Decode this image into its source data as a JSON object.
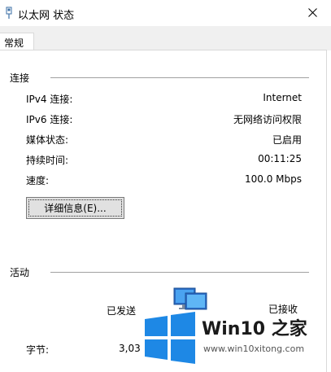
{
  "window": {
    "title": "以太网 状态",
    "close_icon": "close-icon"
  },
  "tabs": [
    {
      "label": "常规"
    }
  ],
  "connection": {
    "label": "连接",
    "rows": [
      {
        "label": "IPv4 连接:",
        "value": "Internet"
      },
      {
        "label": "IPv6 连接:",
        "value": "无网络访问权限"
      },
      {
        "label": "媒体状态:",
        "value": "已启用"
      },
      {
        "label": "持续时间:",
        "value": "00:11:25"
      },
      {
        "label": "速度:",
        "value": "100.0 Mbps"
      }
    ],
    "details_button": "详细信息(E)..."
  },
  "activity": {
    "label": "活动",
    "sent_label": "已发送",
    "received_label": "已接收",
    "bytes_label": "字节:",
    "bytes_sent": "3,03"
  },
  "watermark": {
    "brand": "Win10 之家",
    "url": "www.win10xitong.com",
    "logo_color": "#1e88e5"
  }
}
